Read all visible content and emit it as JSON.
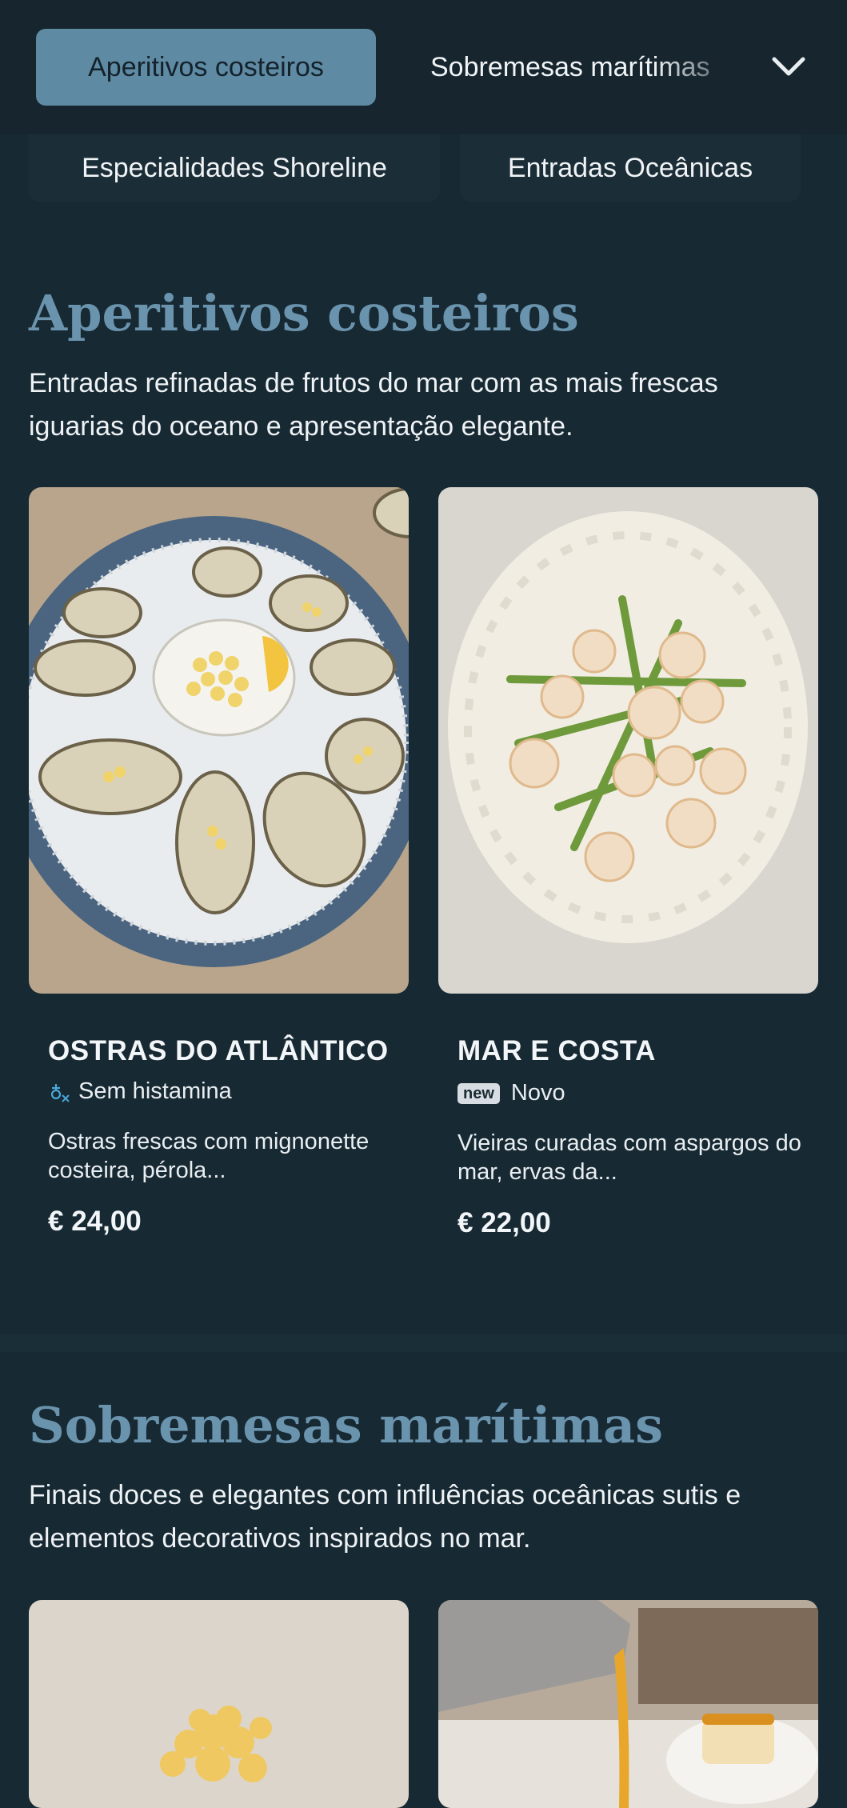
{
  "nav": {
    "tabs": [
      {
        "label": "Aperitivos costeiros",
        "active": true
      },
      {
        "label": "Sobremesas marítimas",
        "active": false
      },
      {
        "label": "Especialidades Shoreline",
        "active": false
      },
      {
        "label": "Entradas Oceânicas",
        "active": false
      }
    ],
    "expand_icon": "chevron-down-icon"
  },
  "sections": [
    {
      "title": "Aperitivos costeiros",
      "description": "Entradas refinadas de frutos do mar com as mais frescas iguarias do oceano e apresentação elegante.",
      "items": [
        {
          "name": "OSTRAS DO ATLÂNTICO",
          "tag_icon": "histamine-free-icon",
          "tag": "Sem histamina",
          "description": "Ostras frescas com mignonette costeira, pérola...",
          "price": "€ 24,00"
        },
        {
          "name": "MAR E COSTA",
          "badge": "new",
          "tag": "Novo",
          "description": "Vieiras curadas com aspargos do mar, ervas da...",
          "price": "€ 22,00"
        }
      ]
    },
    {
      "title": "Sobremesas marítimas",
      "description": "Finais doces e elegantes com influências oceânicas sutis e elementos decorativos inspirados no mar."
    }
  ],
  "colors": {
    "background": "#172933",
    "accent": "#5f8aa3",
    "heading": "#6a93ad"
  }
}
